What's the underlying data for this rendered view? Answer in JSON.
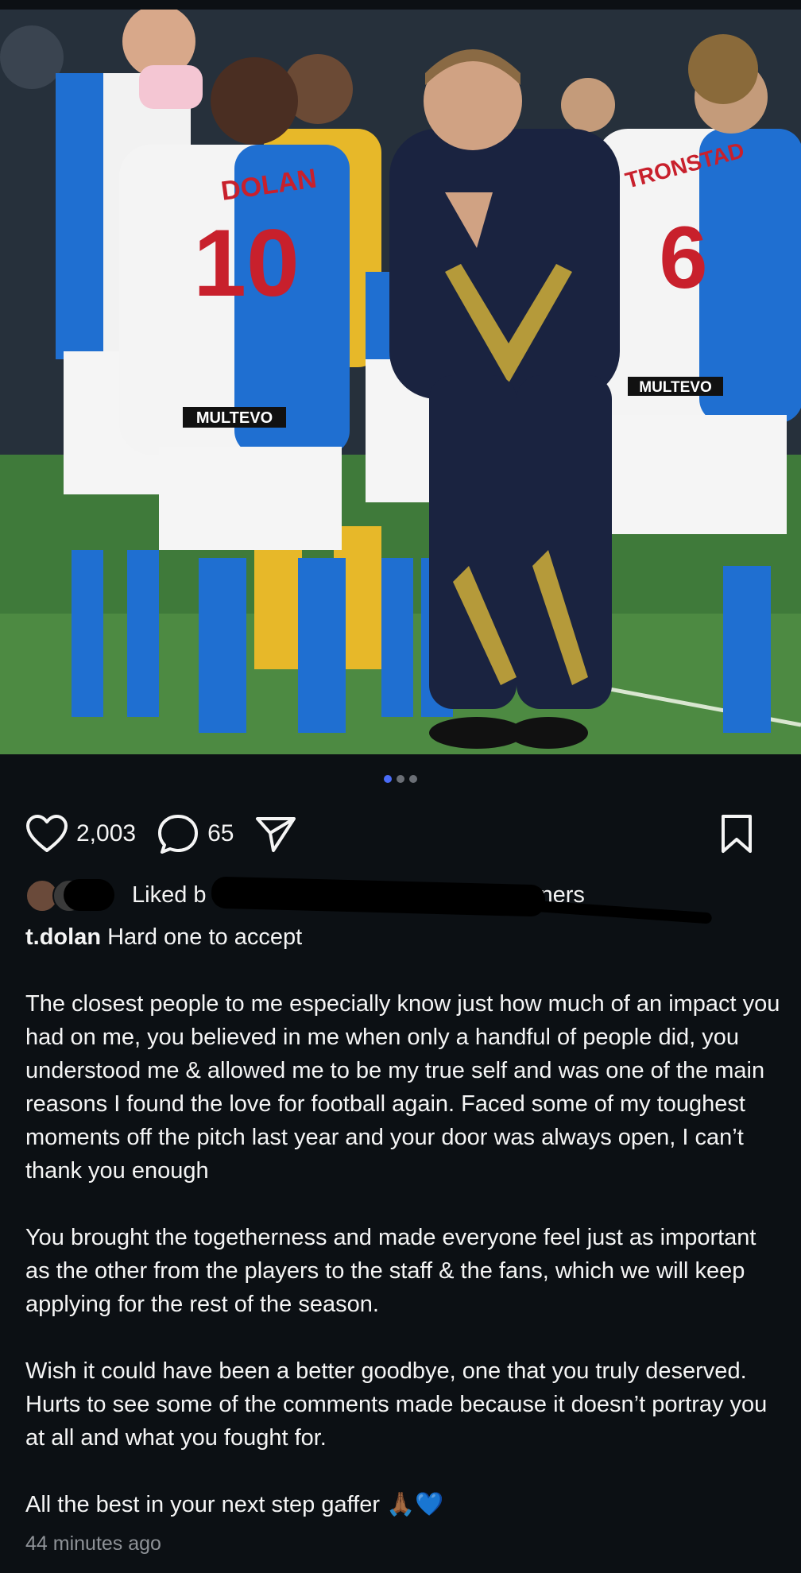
{
  "post": {
    "image_alt": "",
    "carousel": {
      "count": 3,
      "active_index": 0
    },
    "actions": {
      "likes_count": "2,003",
      "comments_count": "65"
    },
    "liked_by": {
      "prefix": "Liked b",
      "suffix": "ners"
    },
    "caption": {
      "username": "t.dolan",
      "first_line": "Hard one to accept",
      "paragraphs": [
        "The closest people to me especially know just how much of an impact you had on me, you believed in me when only a handful of people did, you understood me & allowed me to be my true self and was one of the main reasons I found the love for football again. Faced some of my toughest moments off the pitch last year and your door was always open, I can’t thank you enough",
        "You brought the togetherness and made everyone feel just as important as the other from the players to the staff & the fans, which we will keep applying for the rest of the season.",
        "Wish it could have been a better goodbye, one that you truly deserved. Hurts to see some of the comments made because it doesn’t portray you at all and what you fought for.",
        "All the best in your next step gaffer 🙏🏾💙"
      ]
    },
    "timestamp": "44 minutes ago"
  },
  "photo_text": {
    "shirt_name_left": "DOLAN",
    "shirt_number_left": "10",
    "sponsor": "MULTEVO",
    "shirt_name_right": "TRONSTAD",
    "shirt_number_right": "6"
  },
  "colors": {
    "background": "#0c1014",
    "text": "#f5f5f5",
    "muted": "#8e9297",
    "pager_active": "#4a6cf7",
    "rovers_blue": "#1f6fd1",
    "coach_navy": "#1a2340"
  }
}
